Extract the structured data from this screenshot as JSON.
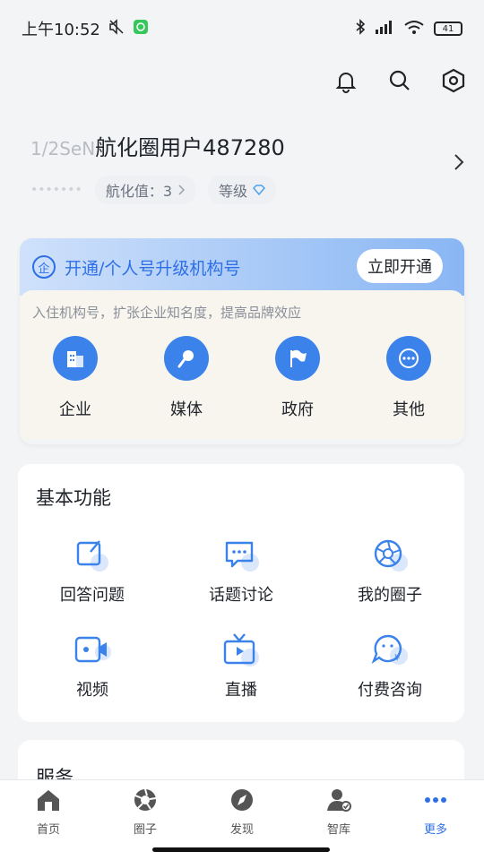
{
  "status_bar": {
    "time": "上午10:52",
    "battery": "41"
  },
  "profile": {
    "name_suffix": "航化圈用户487280",
    "name_blurred": "1/2SeN",
    "hangkhua_value_label": "航化值：3",
    "level_label": "等级"
  },
  "org_card": {
    "badge": "企",
    "title": "开通/个人号升级机构号",
    "button": "立即开通",
    "description": "入住机构号，扩张企业知名度，提高品牌效应",
    "items": [
      {
        "label": "企业",
        "icon": "building-icon"
      },
      {
        "label": "媒体",
        "icon": "microphone-icon"
      },
      {
        "label": "政府",
        "icon": "flag-icon"
      },
      {
        "label": "其他",
        "icon": "more-dots-icon"
      }
    ]
  },
  "basic_features": {
    "title": "基本功能",
    "items": [
      {
        "label": "回答问题",
        "icon": "edit-icon"
      },
      {
        "label": "话题讨论",
        "icon": "chat-icon"
      },
      {
        "label": "我的圈子",
        "icon": "aperture-icon"
      },
      {
        "label": "视频",
        "icon": "video-camera-icon"
      },
      {
        "label": "直播",
        "icon": "tv-icon"
      },
      {
        "label": "付费咨询",
        "icon": "paid-consult-icon"
      }
    ]
  },
  "services": {
    "title": "服务"
  },
  "tabbar": {
    "items": [
      {
        "label": "首页",
        "icon": "home-icon",
        "active": false
      },
      {
        "label": "圈子",
        "icon": "aperture-icon",
        "active": false
      },
      {
        "label": "发现",
        "icon": "compass-icon",
        "active": false
      },
      {
        "label": "智库",
        "icon": "expert-icon",
        "active": false
      },
      {
        "label": "更多",
        "icon": "more-dots-icon",
        "active": true
      }
    ]
  },
  "colors": {
    "accent": "#2e6fe6",
    "page_bg": "#f3f4f6"
  }
}
